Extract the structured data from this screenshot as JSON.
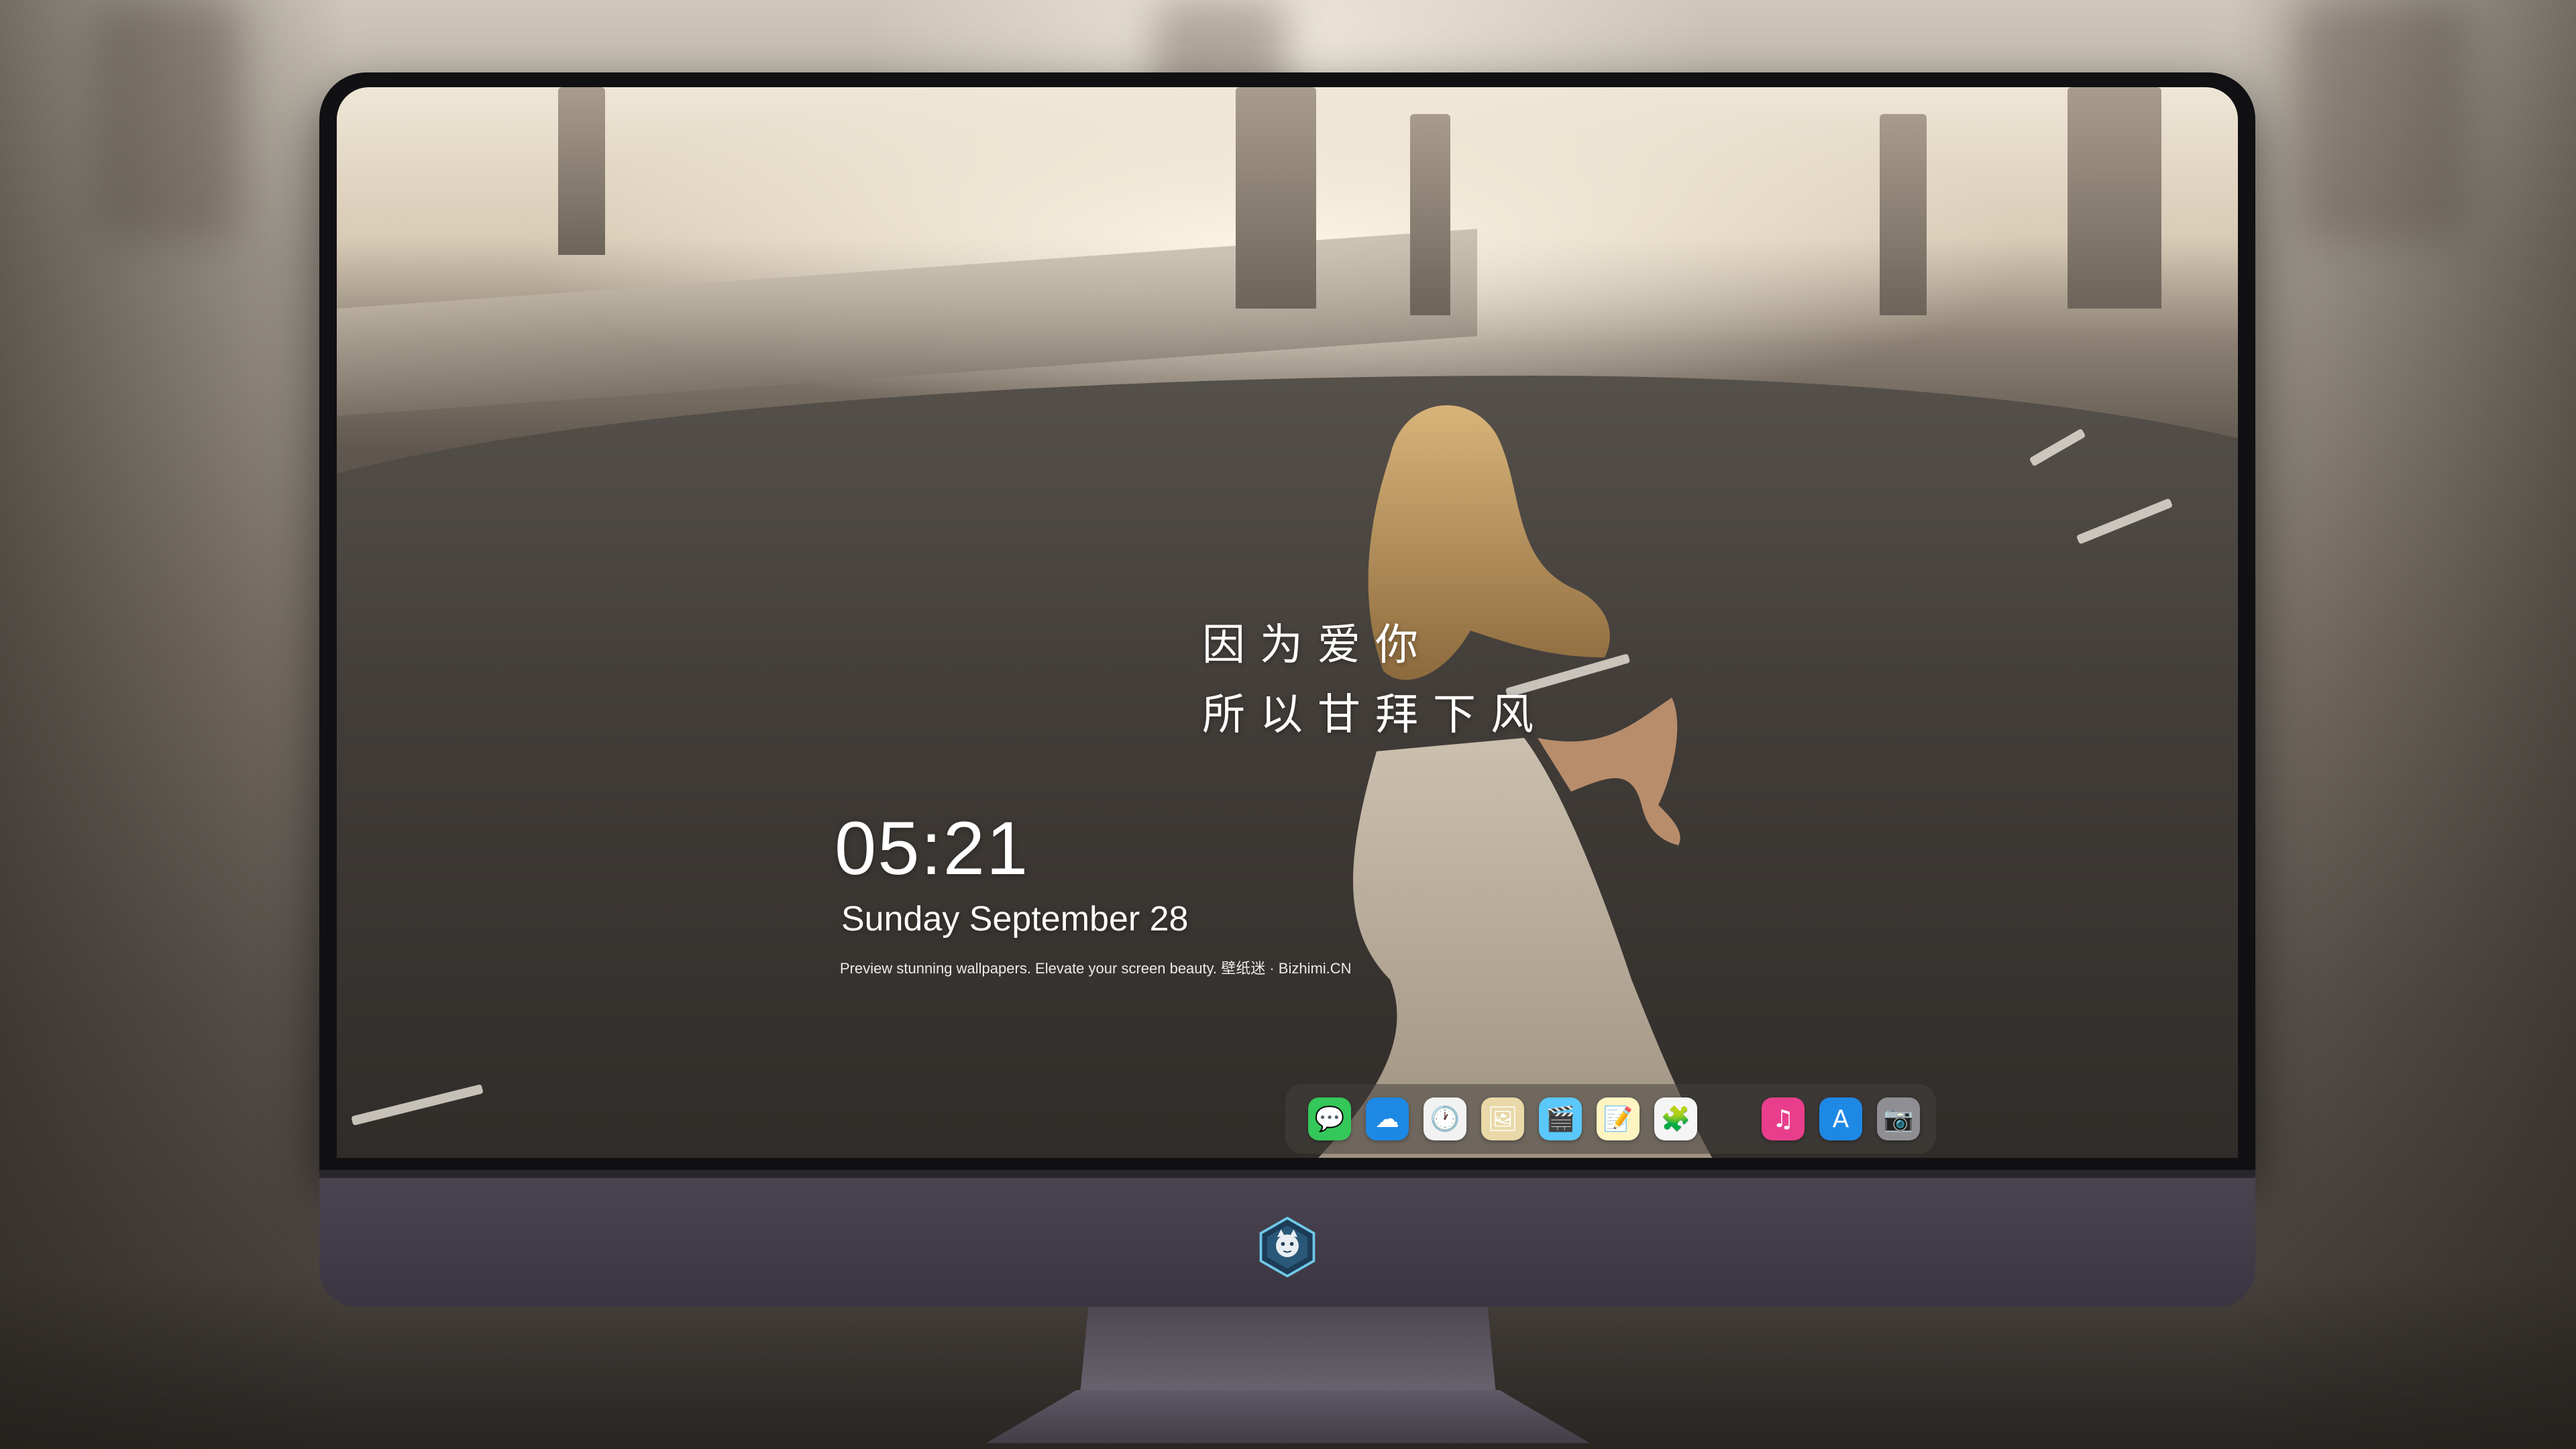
{
  "lockscreen": {
    "quote_line1": "因为爱你",
    "quote_line2": "所以甘拜下风",
    "time": "05:21",
    "date": "Sunday September  28",
    "tagline": "Preview stunning wallpapers. Elevate your screen beauty. 壁纸迷 · Bizhimi.CN"
  },
  "dock": {
    "apps": [
      {
        "name": "messages-icon",
        "glyph": "💬",
        "color": "#34c759"
      },
      {
        "name": "weather-icon",
        "glyph": "☁",
        "color": "#1e88e5"
      },
      {
        "name": "clock-icon",
        "glyph": "🕐",
        "color": "#f2f2f2"
      },
      {
        "name": "preview-icon",
        "glyph": "🖼",
        "color": "#e9d9a8"
      },
      {
        "name": "clips-icon",
        "glyph": "🎬",
        "color": "#5ac8fa"
      },
      {
        "name": "notes-icon",
        "glyph": "📝",
        "color": "#fff5c2"
      },
      {
        "name": "photos-icon",
        "glyph": "🧩",
        "color": "#f5f5f5"
      },
      {
        "name": "music-icon",
        "glyph": "♫",
        "color": "#e83e8c"
      },
      {
        "name": "app-store-icon",
        "glyph": "A",
        "color": "#1e88e5"
      },
      {
        "name": "camera-icon",
        "glyph": "📷",
        "color": "#8e8e93"
      }
    ]
  },
  "colors": {
    "bezel": "#111013",
    "chin": "#3a3540",
    "text": "#ffffff"
  }
}
